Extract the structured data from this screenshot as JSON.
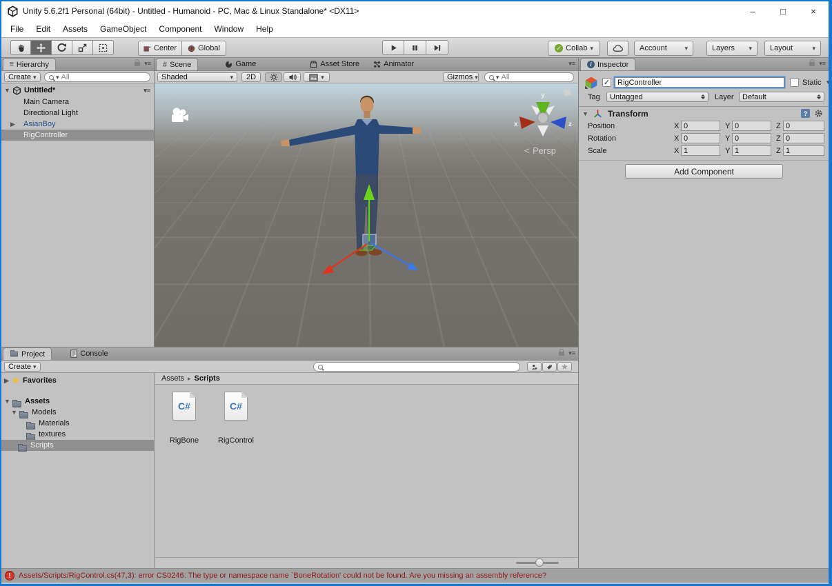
{
  "window": {
    "title": "Unity 5.6.2f1 Personal (64bit) - Untitled - Humanoid - PC, Mac & Linux Standalone* <DX11>"
  },
  "menubar": {
    "items": [
      "File",
      "Edit",
      "Assets",
      "GameObject",
      "Component",
      "Window",
      "Help"
    ]
  },
  "toolbar": {
    "center_label": "Center",
    "global_label": "Global",
    "collab_label": "Collab",
    "account_label": "Account",
    "layers_label": "Layers",
    "layout_label": "Layout"
  },
  "hierarchy": {
    "tab_label": "Hierarchy",
    "create_label": "Create",
    "search_filter": "All",
    "scene_row_label": "Untitled*",
    "items": [
      {
        "label": "Main Camera"
      },
      {
        "label": "Directional Light"
      },
      {
        "label": "AsianBoy"
      },
      {
        "label": "RigController"
      }
    ]
  },
  "scene": {
    "tabs": {
      "scene": "Scene",
      "game": "Game",
      "asset_store": "Asset Store",
      "animator": "Animator"
    },
    "shading_mode": "Shaded",
    "toggle_2d_label": "2D",
    "gizmos_label": "Gizmos",
    "search_filter": "All",
    "persp_label": "Persp",
    "axis_labels": {
      "x": "x",
      "y": "y",
      "z": "z"
    }
  },
  "inspector": {
    "tab_label": "Inspector",
    "name_value": "RigController",
    "static_label": "Static",
    "tag_label": "Tag",
    "tag_value": "Untagged",
    "layer_label": "Layer",
    "layer_value": "Default",
    "transform": {
      "title": "Transform",
      "axis": {
        "x": "X",
        "y": "Y",
        "z": "Z"
      },
      "rows": [
        {
          "label": "Position",
          "x": "0",
          "y": "0",
          "z": "0"
        },
        {
          "label": "Rotation",
          "x": "0",
          "y": "0",
          "z": "0"
        },
        {
          "label": "Scale",
          "x": "1",
          "y": "1",
          "z": "1"
        }
      ]
    },
    "add_component_label": "Add Component"
  },
  "project": {
    "tabs": {
      "project": "Project",
      "console": "Console"
    },
    "create_label": "Create",
    "favorites_label": "Favorites",
    "tree": [
      {
        "label": "Assets"
      },
      {
        "label": "Models"
      },
      {
        "label": "Materials"
      },
      {
        "label": "textures"
      },
      {
        "label": "Scripts"
      }
    ],
    "breadcrumb": {
      "root": "Assets",
      "current": "Scripts"
    },
    "files": [
      {
        "name": "RigBone",
        "badge": "C#"
      },
      {
        "name": "RigControl",
        "badge": "C#"
      }
    ]
  },
  "statusbar": {
    "error_text": "Assets/Scripts/RigControl.cs(47,3): error CS0246: The type or namespace name `BoneRotation' could not be found. Are you missing an assembly reference?"
  },
  "icons": {
    "dropdown": "▾",
    "foldout_open": "▼",
    "foldout_closed": "▶",
    "check": "✓",
    "star": "★",
    "breadcrumb_arrow": "▸",
    "hierarchy_lines": "≡",
    "hash": "#",
    "persp_arrow": "<",
    "window_minimize": "–",
    "window_maximize": "□",
    "window_close": "×"
  },
  "colors": {
    "window_border": "#1377d4",
    "selection_gray": "#8f8f8f",
    "prefab_blue": "#1e4f8b",
    "error_red": "#8e1616",
    "axis_x_red": "#cc3a22",
    "axis_y_green": "#66cc22",
    "axis_z_blue": "#3b6fd4"
  }
}
